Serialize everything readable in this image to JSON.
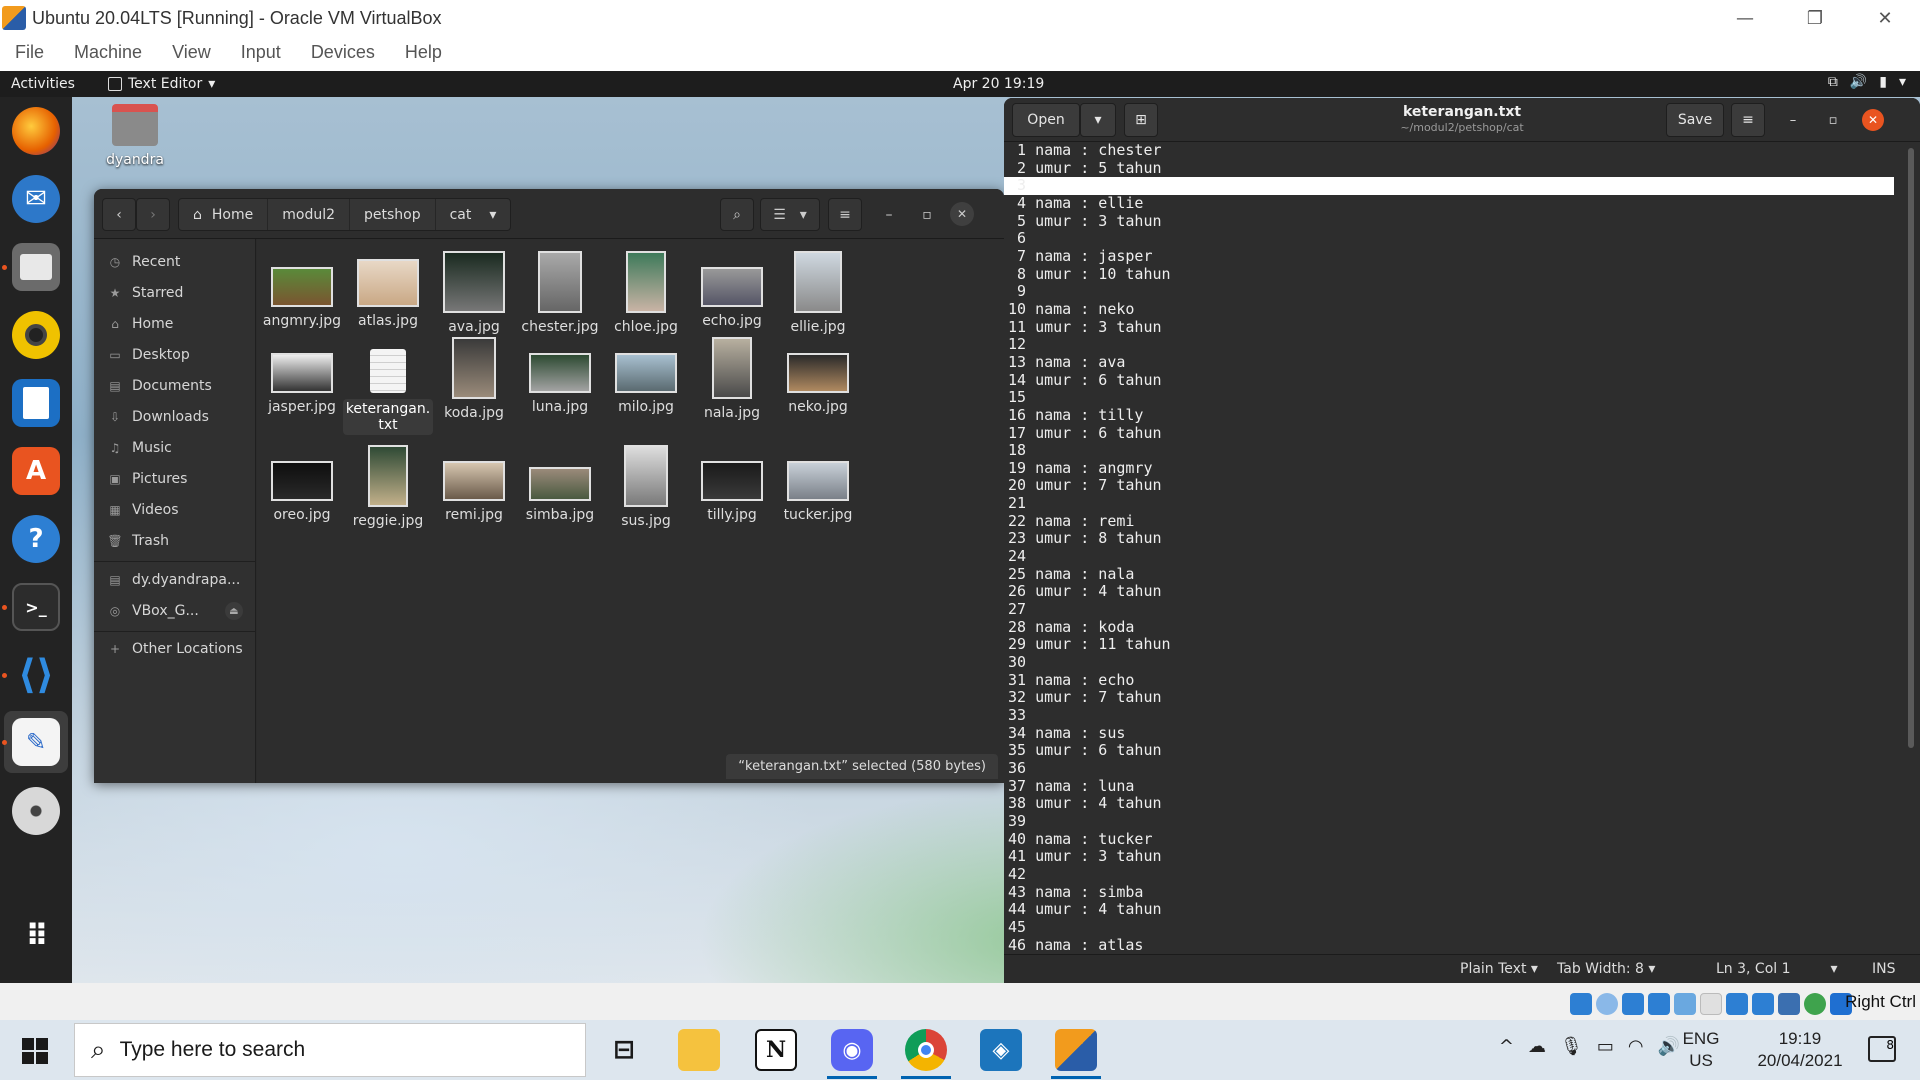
{
  "host": {
    "window_title": "Ubuntu 20.04LTS [Running] - Oracle VM VirtualBox",
    "menu": [
      "File",
      "Machine",
      "View",
      "Input",
      "Devices",
      "Help"
    ],
    "host_key": "Right Ctrl"
  },
  "gnome": {
    "activities": "Activities",
    "app_menu": "Text Editor",
    "clock": "Apr 20  19:19"
  },
  "desktop": {
    "home_label": "dyandra"
  },
  "nautilus": {
    "path": [
      "Home",
      "modul2",
      "petshop",
      "cat"
    ],
    "sidebar": [
      "Recent",
      "Starred",
      "Home",
      "Desktop",
      "Documents",
      "Downloads",
      "Music",
      "Pictures",
      "Videos",
      "Trash",
      "dy.dyandrapa...",
      "VBox_G...",
      "Other Locations"
    ],
    "files": [
      "angmry.jpg",
      "atlas.jpg",
      "ava.jpg",
      "chester.jpg",
      "chloe.jpg",
      "echo.jpg",
      "ellie.jpg",
      "jasper.jpg",
      "keterangan.\ntxt",
      "koda.jpg",
      "luna.jpg",
      "milo.jpg",
      "nala.jpg",
      "neko.jpg",
      "oreo.jpg",
      "reggie.jpg",
      "remi.jpg",
      "simba.jpg",
      "sus.jpg",
      "tilly.jpg",
      "tucker.jpg"
    ],
    "status": "“keterangan.txt” selected  (580 bytes)"
  },
  "gedit": {
    "open_label": "Open",
    "save_label": "Save",
    "title": "keterangan.txt",
    "subtitle": "~/modul2/petshop/cat",
    "text": " 1 nama : chester\n 2 umur : 5 tahun\n 3 \n 4 nama : ellie\n 5 umur : 3 tahun\n 6 \n 7 nama : jasper\n 8 umur : 10 tahun\n 9 \n10 nama : neko\n11 umur : 3 tahun\n12 \n13 nama : ava\n14 umur : 6 tahun\n15 \n16 nama : tilly\n17 umur : 6 tahun\n18 \n19 nama : angmry\n20 umur : 7 tahun\n21 \n22 nama : remi\n23 umur : 8 tahun\n24 \n25 nama : nala\n26 umur : 4 tahun\n27 \n28 nama : koda\n29 umur : 11 tahun\n30 \n31 nama : echo\n32 umur : 7 tahun\n33 \n34 nama : sus\n35 umur : 6 tahun\n36 \n37 nama : luna\n38 umur : 4 tahun\n39 \n40 nama : tucker\n41 umur : 3 tahun\n42 \n43 nama : simba\n44 umur : 4 tahun\n45 \n46 nama : atlas",
    "status": {
      "language": "Plain Text",
      "tab_width": "Tab Width: 8",
      "position": "Ln 3, Col 1",
      "mode": "INS"
    }
  },
  "taskbar": {
    "search_placeholder": "Type here to search",
    "lang_top": "ENG",
    "lang_bottom": "US",
    "time": "19:19",
    "date": "20/04/2021",
    "notif_count": "8"
  },
  "colors": {
    "ubuntu_orange": "#e95420",
    "dark_bg": "#2d2d2d",
    "taskbar_bg": "#dde6ee"
  }
}
